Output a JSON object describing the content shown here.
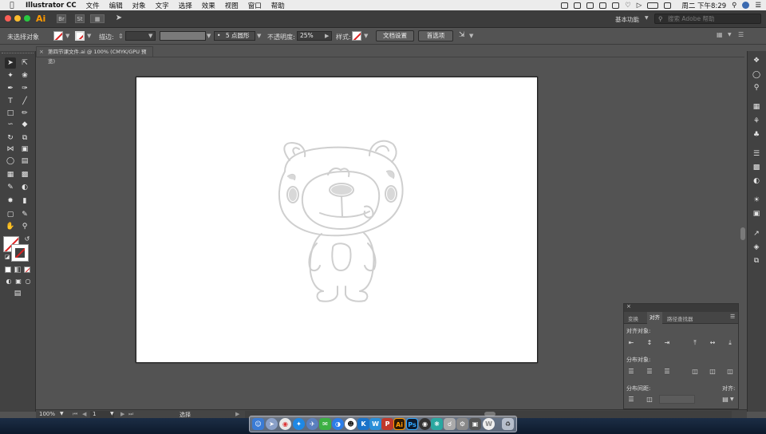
{
  "menubar": {
    "apple": "",
    "app_name": "Illustrator CC",
    "items": [
      "文件",
      "编辑",
      "对象",
      "文字",
      "选择",
      "效果",
      "视图",
      "窗口",
      "帮助"
    ],
    "clock": "周二 下午8:29"
  },
  "appbar": {
    "logo": "Ai",
    "icon_br": "Br",
    "icon_st": "St",
    "workspace": "基本功能",
    "help_placeholder": "搜索 Adobe 帮助"
  },
  "control": {
    "selection_status": "未选择对象",
    "stroke_label": "描边:",
    "brush_value": "5 点圆形",
    "opacity_label": "不透明度:",
    "opacity_value": "25%",
    "style_label": "样式:",
    "doc_setup_button": "文档设置",
    "prefs_button": "首选项"
  },
  "doc_tab": {
    "close": "×",
    "title": "第四节课文件.ai @ 100% (CMYK/GPU 预览)"
  },
  "align_panel": {
    "close": "×",
    "tabs": [
      "变换",
      "对齐",
      "路径查找器"
    ],
    "active_tab": "对齐",
    "align_objects_label": "对齐对象:",
    "distribute_objects_label": "分布对象:",
    "distribute_spacing_label": "分布间距:",
    "align_to_label": "对齐:"
  },
  "statusbar": {
    "zoom": "100%",
    "artboard_num": "1",
    "tool_name": "选择"
  },
  "colors": {
    "ai_orange": "#ff9a00",
    "panel_dark": "#424242",
    "workspace_bg": "#535353",
    "artboard": "#ffffff"
  }
}
